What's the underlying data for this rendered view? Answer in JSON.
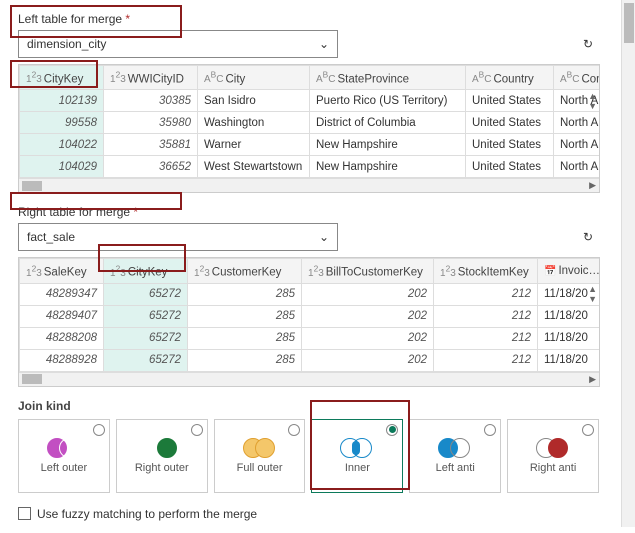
{
  "left": {
    "label": "Left table for merge",
    "required": "*",
    "selected": "dimension_city",
    "cols": [
      {
        "type": "123",
        "name": "CityKey",
        "w": 84,
        "sel": true
      },
      {
        "type": "123",
        "name": "WWICityID",
        "w": 94
      },
      {
        "type": "ABC",
        "name": "City",
        "w": 112
      },
      {
        "type": "ABC",
        "name": "StateProvince",
        "w": 156
      },
      {
        "type": "ABC",
        "name": "Country",
        "w": 88
      },
      {
        "type": "ABC",
        "name": "Continent",
        "w": 70
      }
    ],
    "rows": [
      [
        "102139",
        "30385",
        "San Isidro",
        "Puerto Rico (US Territory)",
        "United States",
        "North Amer"
      ],
      [
        "99558",
        "35980",
        "Washington",
        "District of Columbia",
        "United States",
        "North Amer"
      ],
      [
        "104022",
        "35881",
        "Warner",
        "New Hampshire",
        "United States",
        "North Amer"
      ],
      [
        "104029",
        "36652",
        "West Stewartstown",
        "New Hampshire",
        "United States",
        "North Amer"
      ]
    ]
  },
  "right": {
    "label": "Right table for merge",
    "required": "*",
    "selected": "fact_sale",
    "cols": [
      {
        "type": "123",
        "name": "SaleKey",
        "w": 84
      },
      {
        "type": "123",
        "name": "CityKey",
        "w": 84,
        "sel": true
      },
      {
        "type": "123",
        "name": "CustomerKey",
        "w": 114
      },
      {
        "type": "123",
        "name": "BillToCustomerKey",
        "w": 132
      },
      {
        "type": "123",
        "name": "StockItemKey",
        "w": 104
      },
      {
        "type": "cal",
        "name": "InvoiceDa",
        "w": 72
      }
    ],
    "rows": [
      [
        "48289347",
        "65272",
        "285",
        "202",
        "212",
        "11/18/20"
      ],
      [
        "48289407",
        "65272",
        "285",
        "202",
        "212",
        "11/18/20"
      ],
      [
        "48288208",
        "65272",
        "285",
        "202",
        "212",
        "11/18/20"
      ],
      [
        "48288928",
        "65272",
        "285",
        "202",
        "212",
        "11/18/20"
      ]
    ]
  },
  "joinkind": {
    "label": "Join kind",
    "options": [
      {
        "label": "Left outer",
        "c1": "#c24fc2",
        "c2": "#fff",
        "f1": "#c24fc2",
        "f2": "transparent"
      },
      {
        "label": "Right outer",
        "c1": "#fff",
        "c2": "#1c7a3a",
        "f1": "transparent",
        "f2": "#1c7a3a"
      },
      {
        "label": "Full outer",
        "c1": "#e0a030",
        "c2": "#e0a030",
        "f1": "#f4c76a",
        "f2": "#f4c76a"
      },
      {
        "label": "Inner",
        "c1": "#1889c9",
        "c2": "#1889c9",
        "f1": "transparent",
        "f2": "transparent",
        "sel": true,
        "mid": "#1889c9"
      },
      {
        "label": "Left anti",
        "c1": "#1889c9",
        "c2": "#888",
        "f1": "#1889c9",
        "f2": "transparent"
      },
      {
        "label": "Right anti",
        "c1": "#888",
        "c2": "#b02a2a",
        "f1": "transparent",
        "f2": "#b02a2a"
      }
    ]
  },
  "fuzzy": "Use fuzzy matching to perform the merge"
}
